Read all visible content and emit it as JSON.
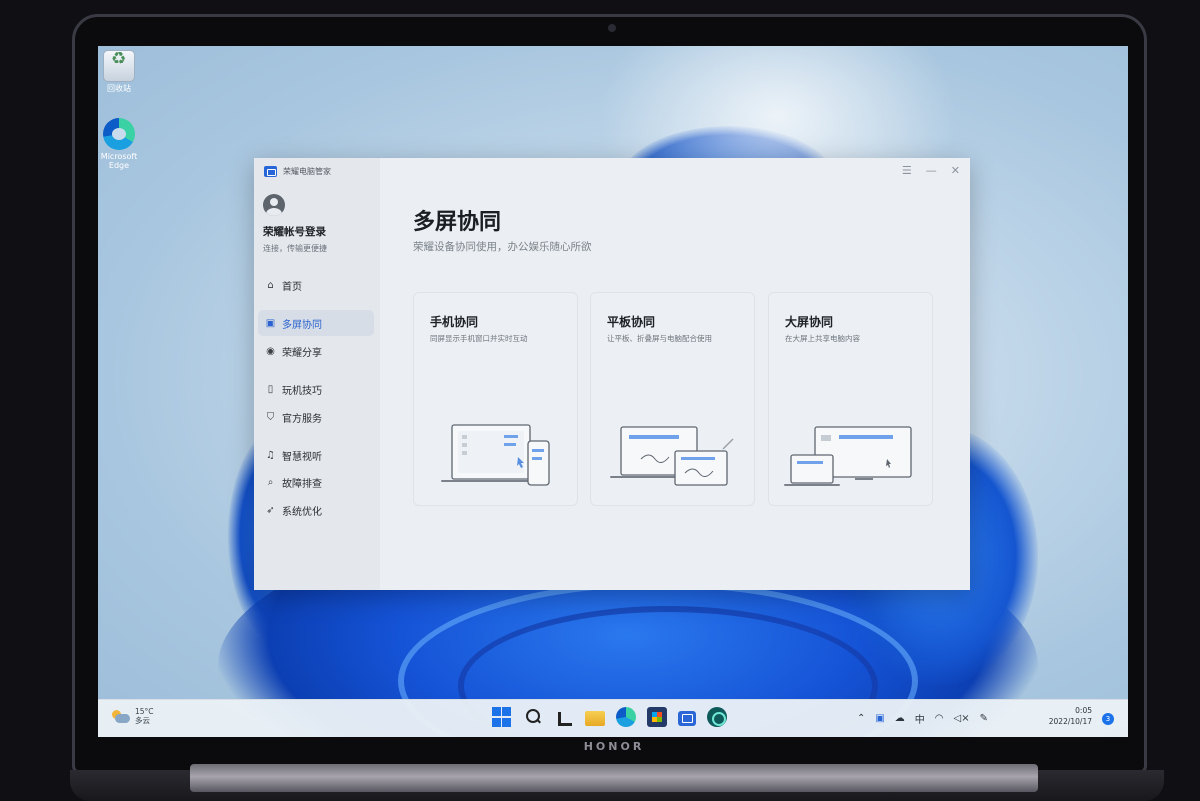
{
  "device": {
    "brand": "HONOR"
  },
  "desktop": {
    "icons": [
      {
        "label": "回收站",
        "icon": "recycle-bin-icon"
      },
      {
        "label": "Microsoft Edge",
        "icon": "edge-icon"
      }
    ]
  },
  "app": {
    "name": "荣耀电脑管家",
    "account": {
      "title": "荣耀帐号登录",
      "subtitle": "连接，传输更便捷"
    },
    "nav": [
      {
        "label": "首页",
        "icon": "home-icon",
        "active": false
      },
      {
        "label": "多屏协同",
        "icon": "multi-screen-icon",
        "active": true
      },
      {
        "label": "荣耀分享",
        "icon": "share-icon",
        "active": false
      },
      {
        "label": "玩机技巧",
        "icon": "tips-icon",
        "active": false
      },
      {
        "label": "官方服务",
        "icon": "service-icon",
        "active": false
      },
      {
        "label": "智慧视听",
        "icon": "audio-icon",
        "active": false
      },
      {
        "label": "故障排查",
        "icon": "troubleshoot-icon",
        "active": false
      },
      {
        "label": "系统优化",
        "icon": "optimize-icon",
        "active": false
      }
    ],
    "window_controls": {
      "menu": "☰",
      "minimize": "—",
      "close": "✕"
    },
    "main": {
      "title": "多屏协同",
      "subtitle": "荣耀设备协同使用，办公娱乐随心所欲",
      "cards": [
        {
          "title": "手机协同",
          "desc": "同屏显示手机窗口并实时互动",
          "illustration": "phone-laptop-illustration"
        },
        {
          "title": "平板协同",
          "desc": "让平板、折叠屏与电脑配合使用",
          "illustration": "tablet-laptop-illustration"
        },
        {
          "title": "大屏协同",
          "desc": "在大屏上共享电脑内容",
          "illustration": "bigscreen-laptop-illustration"
        }
      ]
    }
  },
  "taskbar": {
    "weather": {
      "temp": "15°C",
      "condition": "多云"
    },
    "tray": {
      "ime": "中"
    },
    "clock": {
      "time": "0:05",
      "date": "2022/10/17"
    },
    "notifications": "3"
  },
  "colors": {
    "accent": "#2a62cf",
    "taskbar": "#eaf0f6",
    "window": "#ebeff3"
  }
}
